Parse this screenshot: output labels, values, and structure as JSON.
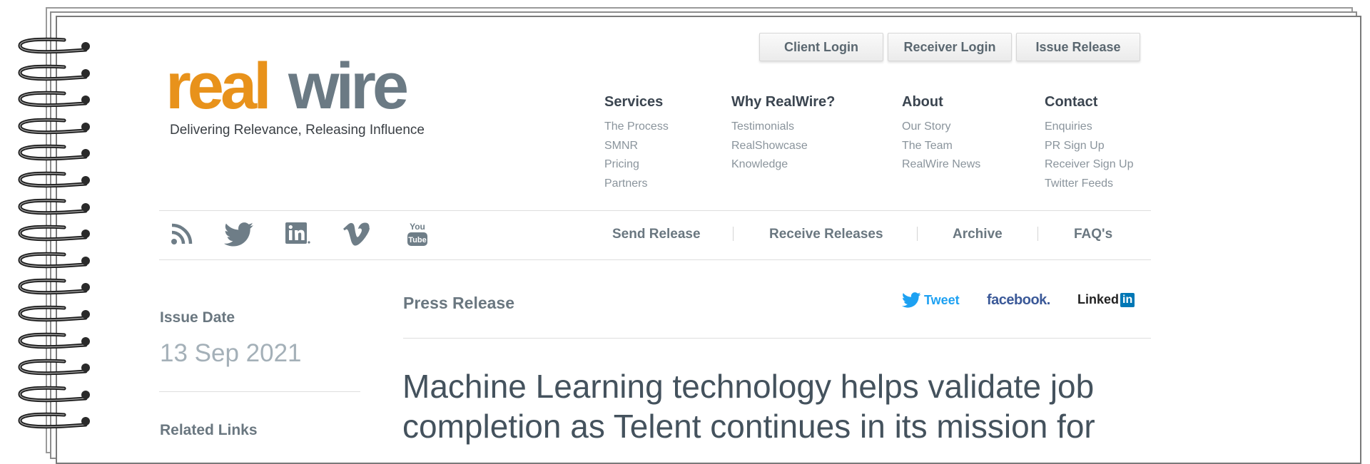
{
  "top_buttons": {
    "client_login": "Client Login",
    "receiver_login": "Receiver Login",
    "issue_release": "Issue Release"
  },
  "logo": {
    "part1": "real",
    "part2": "wire",
    "tagline": "Delivering Relevance, Releasing Influence",
    "colors": {
      "real": "#e8921b",
      "wire": "#6b7a84"
    }
  },
  "nav": [
    {
      "heading": "Services",
      "links": [
        "The Process",
        "SMNR",
        "Pricing",
        "Partners"
      ]
    },
    {
      "heading": "Why RealWire?",
      "links": [
        "Testimonials",
        "RealShowcase",
        "Knowledge"
      ]
    },
    {
      "heading": "About",
      "links": [
        "Our Story",
        "The Team",
        "RealWire News"
      ]
    },
    {
      "heading": "Contact",
      "links": [
        "Enquiries",
        "PR Sign Up",
        "Receiver Sign Up",
        "Twitter Feeds"
      ]
    }
  ],
  "social_icons": [
    "rss-icon",
    "twitter-icon",
    "linkedin-icon",
    "vimeo-icon",
    "youtube-icon"
  ],
  "youtube_text": {
    "top": "You",
    "bottom": "Tube"
  },
  "subnav": [
    "Send Release",
    "Receive Releases",
    "Archive",
    "FAQ's"
  ],
  "sidebar": {
    "issue_label": "Issue Date",
    "issue_date": "13 Sep 2021",
    "related_links": "Related Links"
  },
  "press": {
    "label": "Press Release",
    "share": {
      "tweet": "Tweet",
      "facebook": "facebook.",
      "linkedin": "Linked",
      "linkedin_in": "in"
    }
  },
  "headline": "Machine Learning technology helps validate job completion as Telent continues in its mission for",
  "colors": {
    "accent_orange": "#e8921b",
    "slate": "#6b7a84",
    "twitter_blue": "#1da1f2",
    "facebook_blue": "#3b5998",
    "linkedin_blue": "#0077b5"
  }
}
